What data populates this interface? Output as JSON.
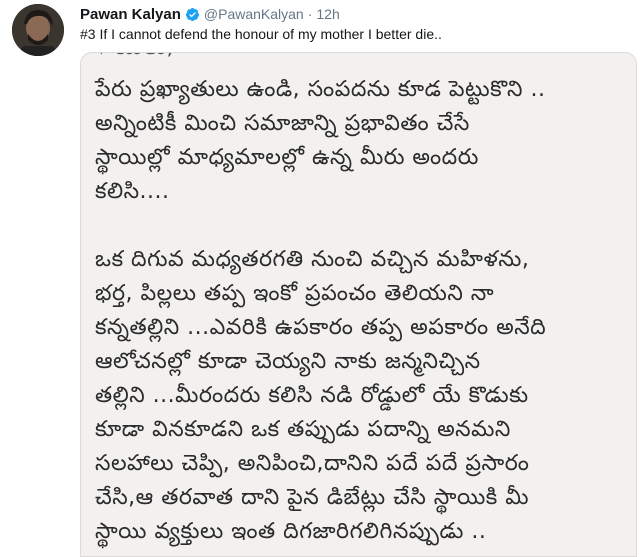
{
  "tweet": {
    "author": {
      "name": "Pawan Kalyan",
      "handle": "@PawanKalyan",
      "verified": true,
      "avatar_icon": "profile-photo"
    },
    "separator": "·",
    "timestamp": "12h",
    "text": "#3 If I cannot defend the honour of my mother I better die..",
    "media": {
      "lines": [
        "పేరు ప్రఖ్యాతులు ఉండి, సంపదను కూడ పెట్టుకొని ..",
        "అన్నింటికీ మించి సమాజాన్ని ప్రభావితం చేసే",
        "స్థాయిల్లో మాధ్యమాలల్లో ఉన్న మీరు అందరు",
        "కలిసి....",
        "",
        "ఒక దిగువ మధ్యతరగతి నుంచి వచ్చిన మహిళను,",
        "భర్త, పిల్లలు తప్ప ఇంకో ప్రపంచం తెలియని నా",
        "కన్నతల్లిని ...ఎవరికి ఉపకారం తప్ప అపకారం అనేది",
        "ఆలోచనల్లో కూడా చెయ్యని నాకు జన్మనిచ్చిన",
        "తల్లిని ...మీరందరు కలిసి నడి రోడ్డులో యే కొడుకు",
        "కూడా వినకూడని ఒక తప్పుడు పదాన్ని అనమని",
        "సలహాలు చెప్పి, అనిపించి,దానిని పదే పదే ప్రసారం",
        "చేసి,ఆ తరవాత దాని పైన డిబేట్లు చేసి స్థాయికి మీ",
        "స్థాయి వ్యక్తులు  ఇంత దిగజారిగలిగినప్పుడు .."
      ]
    }
  },
  "colors": {
    "name": "#14171a",
    "secondary": "#657786",
    "verified": "#1da1f2",
    "paper": "#f3f1ef",
    "ink": "#2b2b2b"
  }
}
